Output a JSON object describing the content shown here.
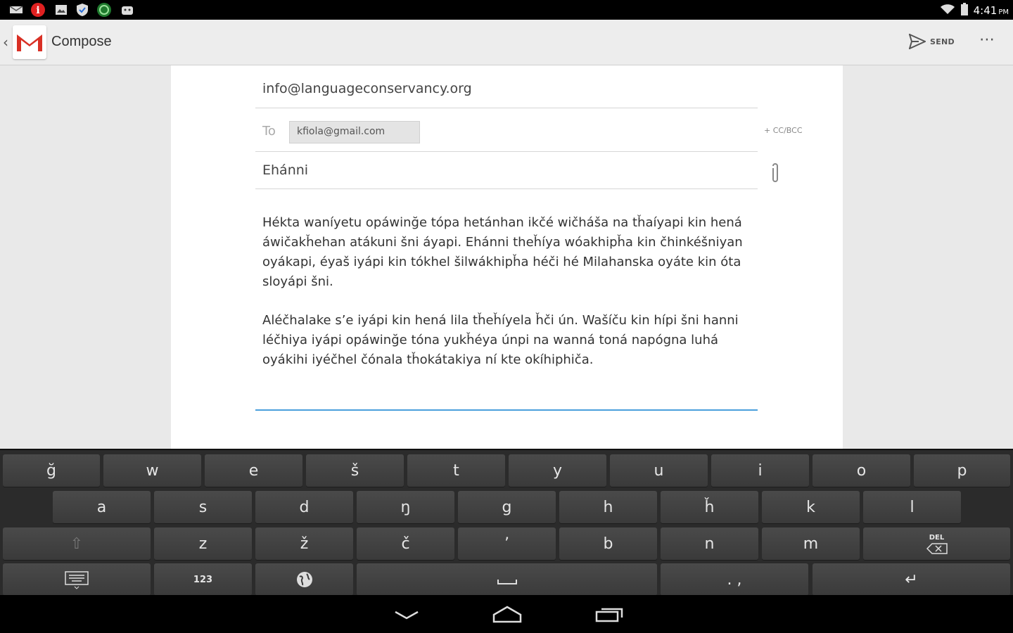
{
  "status": {
    "time": "4:41",
    "ampm": "PM",
    "icons": [
      "email-icon",
      "app-red-icon",
      "image-icon",
      "shield-icon",
      "recycle-icon",
      "android-icon"
    ]
  },
  "actionbar": {
    "back_symbol": "‹",
    "title": "Compose",
    "send_label": "SEND",
    "more_symbol": "⋯"
  },
  "compose": {
    "from": "info@languageconservancy.org",
    "to_label": "To",
    "recipient": "kfiola@gmail.com",
    "cc_bcc": "+ CC/BCC",
    "subject": "Ehánni",
    "body_paragraphs": [
      "Hékta waníyetu opáwinğe tópa hetánhan ikčé wičháša na tȟaíyapi kin hená áwičakȟehan atákuni šni áyapi. Ehánni theȟíya wóakhipȟa kin čhinkéšniyan oyákapi, éyaš iyápi kin tókhel šilwákhipȟa héči hé Milahanska oyáte kin óta sloyápi šni.",
      "Aléčhalake s’e iyápi kin hená lila tȟeȟíyela ȟči ún. Wašíču kin hípi šni hanni léčhiya iyápi opáwinğe tóna yukȟéya únpi na wanná toná napógna luhá oyákihi iyéčhel čónala tȟokátakiya ní kte okíhiphiča."
    ]
  },
  "keyboard": {
    "row1": [
      "ğ",
      "w",
      "e",
      "š",
      "t",
      "y",
      "u",
      "i",
      "o",
      "p"
    ],
    "row2": [
      "a",
      "s",
      "d",
      "ŋ",
      "g",
      "h",
      "ȟ",
      "k",
      "l"
    ],
    "row3": [
      "⇧",
      "z",
      "ž",
      "č",
      "’",
      "b",
      "n",
      "m",
      "DEL"
    ],
    "row4": [
      "⌨",
      "123",
      "🌐",
      "␣",
      ". ,",
      "↵"
    ]
  },
  "colors": {
    "accent_blue": "#4a9fdc",
    "gmail_red": "#d93025",
    "keyboard_bg": "#2b2b2b",
    "key_bg": "#444444"
  }
}
